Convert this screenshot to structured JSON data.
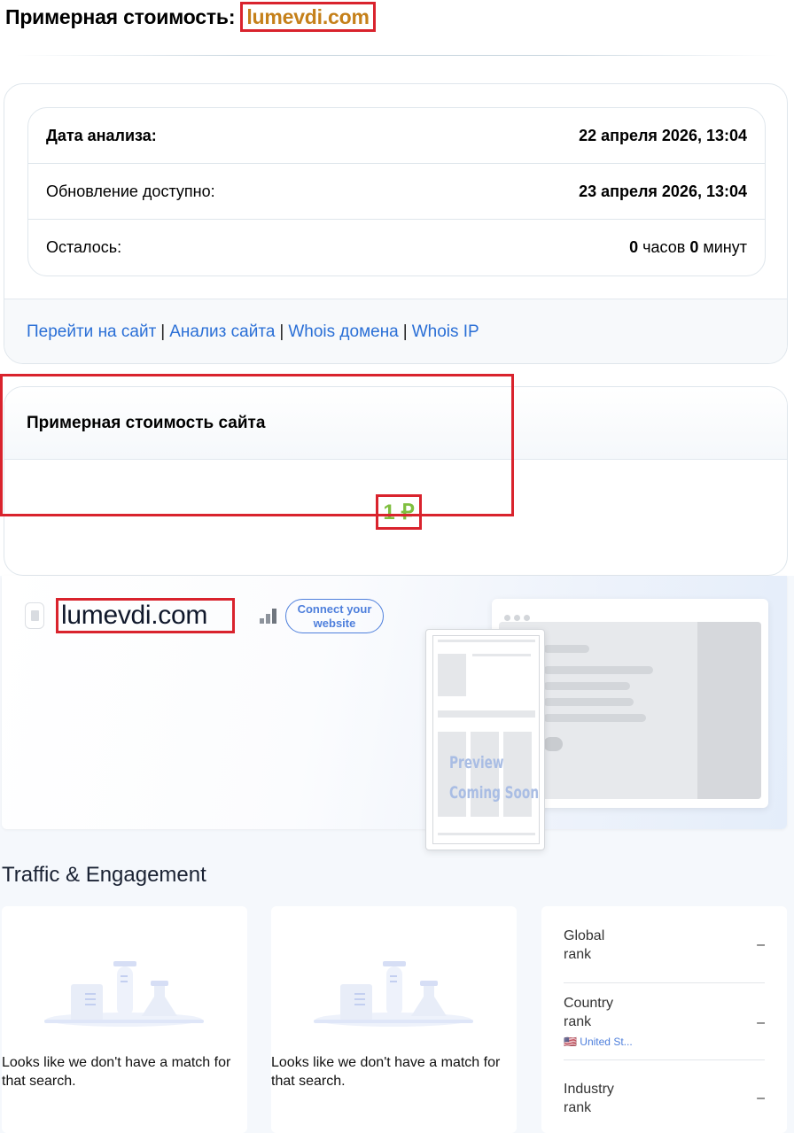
{
  "heading": {
    "label": "Примерная стоимость:",
    "domain": "lumevdi.com"
  },
  "analysis": {
    "rows": [
      {
        "label": "Дата анализа:",
        "value": "22 апреля 2026, 13:04"
      },
      {
        "label": "Обновление доступно:",
        "value": "23 апреля 2026, 13:04"
      },
      {
        "label": "Осталось:",
        "hours": "0",
        "hours_unit": "часов",
        "minutes": "0",
        "minutes_unit": "минут"
      }
    ],
    "links": [
      "Перейти на сайт",
      "Анализ сайта",
      "Whois домена",
      "Whois IP"
    ],
    "separator": "|"
  },
  "value_card": {
    "title": "Примерная стоимость сайта",
    "price": "1 ₽"
  },
  "hero": {
    "site_name": "lumevdi.com",
    "connect_button": "Connect your website",
    "preview_text_1": "Preview",
    "preview_text_2": "Coming Soon"
  },
  "traffic": {
    "section_title": "Traffic & Engagement",
    "empty_message": "Looks like we don't have a match for that search.",
    "ranks": [
      {
        "label": "Global rank",
        "value": "–"
      },
      {
        "label": "Country rank",
        "value": "–",
        "country": "United St..."
      },
      {
        "label": "Industry rank",
        "value": "–"
      }
    ]
  },
  "colors": {
    "accent_link": "#2a6fd6",
    "highlight": "#d9232d",
    "price": "#7fbf3f",
    "domain": "#c5801a",
    "connect": "#4e7fdc"
  }
}
